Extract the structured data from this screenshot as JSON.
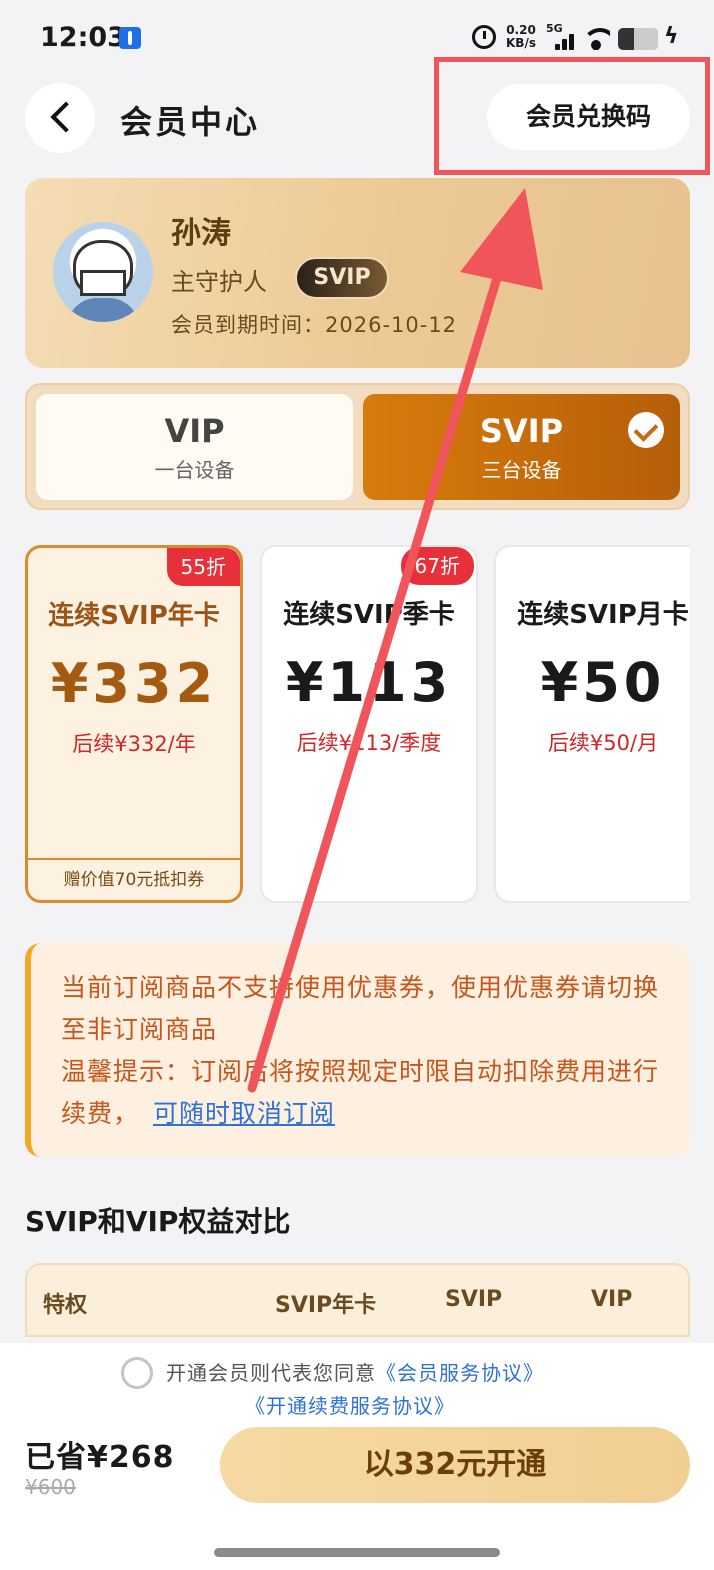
{
  "status_bar": {
    "time": "12:03",
    "net_speed_value": "0.20",
    "net_speed_unit": "KB/s",
    "network_type": "5G",
    "battery_level": 0.6
  },
  "header": {
    "title": "会员中心",
    "redeem_label": "会员兑换码"
  },
  "profile": {
    "name": "孙涛",
    "role": "主守护人",
    "badge": "SVIP",
    "expire_label": "会员到期时间：",
    "expire_date": "2026-10-12"
  },
  "tiers": [
    {
      "name": "VIP",
      "desc": "一台设备",
      "selected": false
    },
    {
      "name": "SVIP",
      "desc": "三台设备",
      "selected": true
    }
  ],
  "plans": [
    {
      "name": "连续SVIP年卡",
      "discount": "55折",
      "price": "¥332",
      "renew": "后续¥332/年",
      "gift": "赠价值70元抵扣券",
      "selected": true
    },
    {
      "name": "连续SVIP季卡",
      "discount": "67折",
      "price": "¥113",
      "renew": "后续¥113/季度",
      "gift": "",
      "selected": false
    },
    {
      "name": "连续SVIP月卡",
      "discount": "",
      "price": "¥50",
      "renew": "后续¥50/月",
      "gift": "",
      "selected": false
    }
  ],
  "notice": {
    "line1": "当前订阅商品不支持使用优惠券，使用优惠券请切换至非订阅商品",
    "line2": "温馨提示：订阅后将按照规定时限自动扣除费用进行续费，",
    "cancel_link": "可随时取消订阅"
  },
  "comparison": {
    "title": "SVIP和VIP权益对比",
    "columns": [
      "特权",
      "SVIP年卡",
      "SVIP",
      "VIP"
    ]
  },
  "bottom": {
    "agree_prefix": "开通会员则代表您同意",
    "agreement1": "《会员服务协议》",
    "agreement2": "《开通续费服务协议》",
    "saved": "已省¥268",
    "original_price": "¥600",
    "open_button": "以332元开通"
  },
  "colors": {
    "accent": "#d87b0c",
    "highlight": "#f0555c",
    "link": "#2f72d6",
    "price_red": "#d02626"
  }
}
